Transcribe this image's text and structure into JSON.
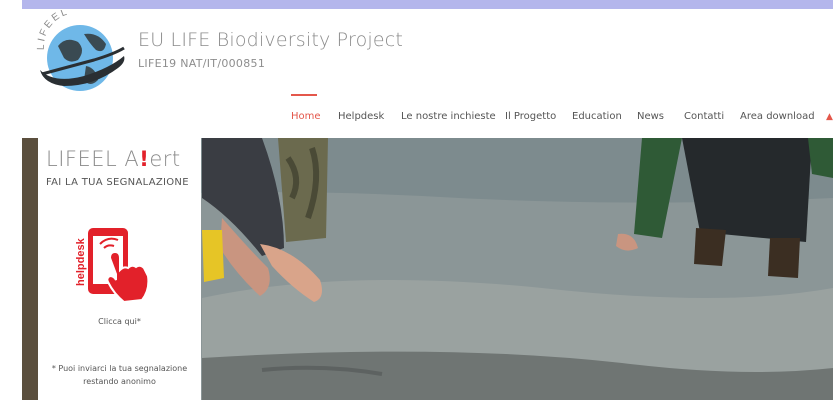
{
  "header": {
    "title": "EU LIFE Biodiversity Project",
    "subtitle": "LIFE19 NAT/IT/000851",
    "logo_text": "LIFEEL"
  },
  "nav": {
    "items": [
      {
        "label": "Home",
        "active": true
      },
      {
        "label": "Helpdesk"
      },
      {
        "label": "Le nostre inchieste"
      },
      {
        "label": "Il Progetto"
      },
      {
        "label": "Education"
      },
      {
        "label": "News"
      },
      {
        "label": "Contatti"
      },
      {
        "label": "Area download"
      }
    ]
  },
  "alert": {
    "title_start": "LIFEEL A",
    "title_bang": "!",
    "title_end": "ert",
    "subtitle": "FAI LA TUA SEGNALAZIONE",
    "icon_label": "helpdesk",
    "click_label": "Clicca qui*",
    "note_line1": "* Puoi inviarci la tua segnalazione",
    "note_line2": "restando anonimo"
  },
  "colors": {
    "accent": "#e4574b",
    "alert_red": "#e2212a",
    "top_strip": "#b4b6ec"
  }
}
